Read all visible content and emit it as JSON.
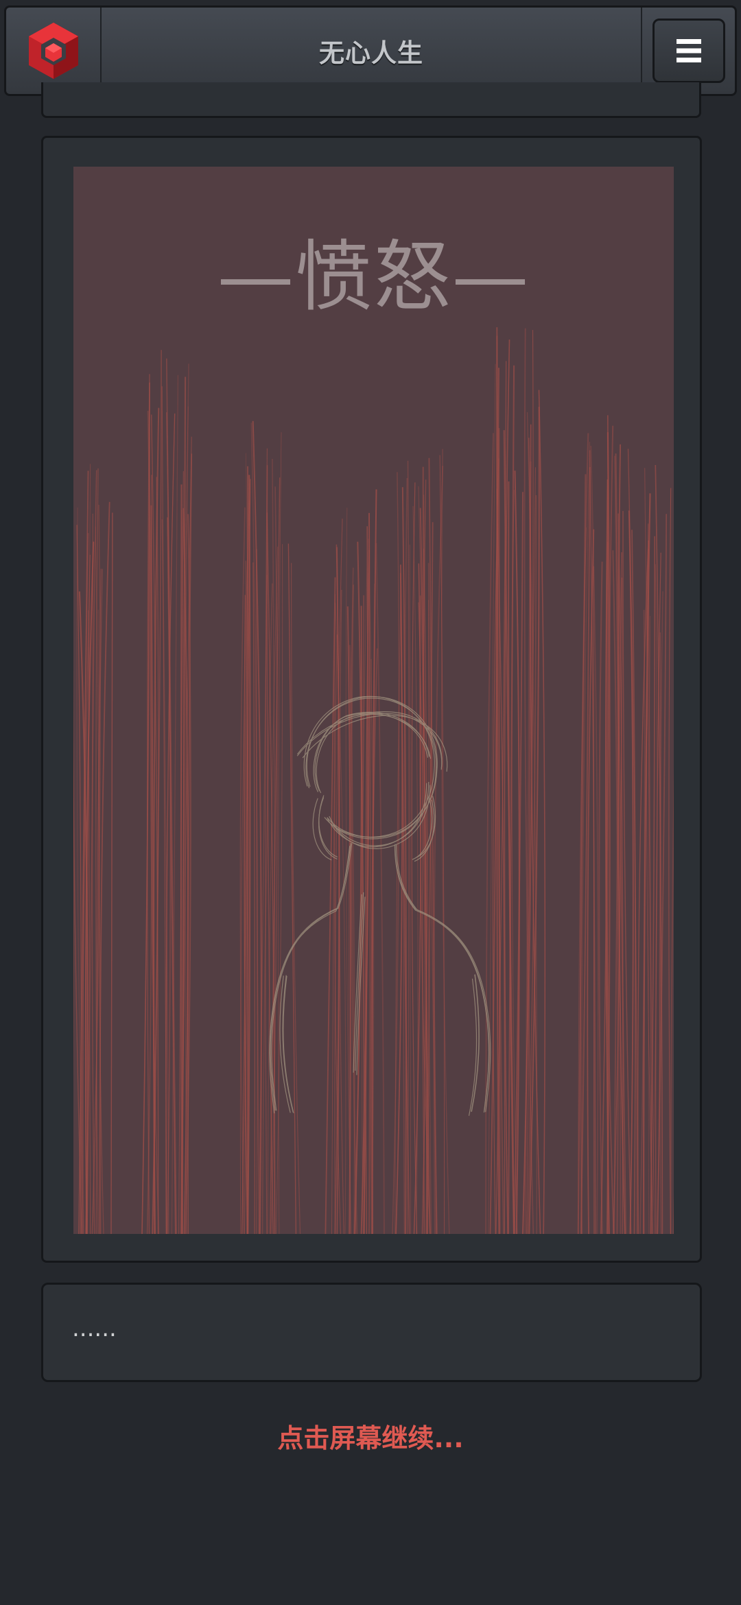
{
  "header": {
    "title": "无心人生",
    "logo_icon": "red-cube-logo-icon",
    "menu_icon": "hamburger-menu-icon"
  },
  "scene": {
    "title": "—愤怒—",
    "colors": {
      "background": "#533e43",
      "rain_strokes": "#a04e48",
      "figure_strokes": "#a69a84",
      "title": "#9c8f91"
    }
  },
  "dialog": {
    "text": "......"
  },
  "prompt": {
    "continue_text": "点击屏幕继续..."
  },
  "colors": {
    "page_background": "#25282d",
    "accent": "#e05a52",
    "logo_red": "#d8252a"
  }
}
